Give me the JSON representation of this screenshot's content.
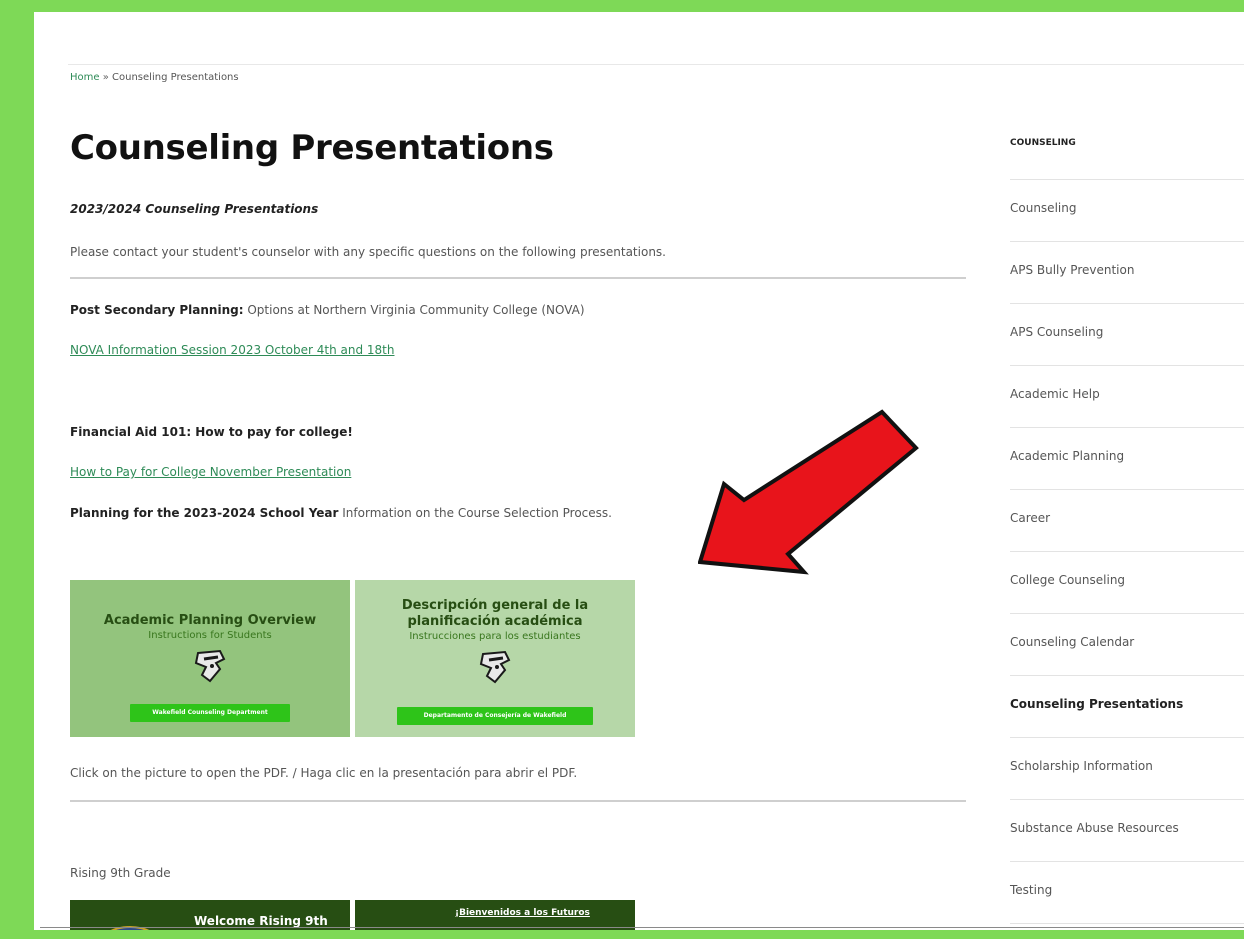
{
  "breadcrumb": {
    "home": "Home",
    "separator": "»",
    "current": "Counseling Presentations"
  },
  "page_title": "Counseling Presentations",
  "subtitle": "2023/2024 Counseling Presentations",
  "intro": "Please contact your student's counselor with any specific questions on the following presentations.",
  "post_secondary": {
    "bold": "Post Secondary Planning:",
    "text": " Options at Northern Virginia Community College (NOVA)"
  },
  "nova_link": "NOVA Information Session 2023 October 4th and 18th",
  "financial_aid": "Financial Aid 101: How to pay for college!",
  "pay_link": "How to Pay for College November Presentation",
  "planning": {
    "bold": "Planning for the 2023-2024 School Year",
    "text": " Information on the Course Selection Process."
  },
  "tiles": [
    {
      "title": "Academic Planning Overview",
      "subtitle": "Instructions for Students",
      "dept": "Wakefield Counseling Department"
    },
    {
      "title": "Descripción general de la planificación académica",
      "subtitle": "Instrucciones para los estudiantes",
      "dept": "Departamento de Consejería de Wakefield"
    }
  ],
  "click_note": "Click on the picture to open the PDF.  / Haga clic en la presentación para abrir el PDF.",
  "rising": "Rising 9th Grade",
  "rising_tiles": {
    "en": "Welcome Rising 9th",
    "es": "¡Bienvenidos a los Futuros"
  },
  "sidebar": {
    "heading": "COUNSELING",
    "items": [
      {
        "label": "Counseling",
        "active": false
      },
      {
        "label": "APS Bully Prevention",
        "active": false
      },
      {
        "label": "APS Counseling",
        "active": false
      },
      {
        "label": "Academic Help",
        "active": false
      },
      {
        "label": "Academic Planning",
        "active": false
      },
      {
        "label": "Career",
        "active": false
      },
      {
        "label": "College Counseling",
        "active": false
      },
      {
        "label": "Counseling Calendar",
        "active": false
      },
      {
        "label": "Counseling Presentations",
        "active": true
      },
      {
        "label": "Scholarship Information",
        "active": false
      },
      {
        "label": "Substance Abuse Resources",
        "active": false
      },
      {
        "label": "Testing",
        "active": false
      }
    ]
  },
  "colors": {
    "frame": "#7ed957",
    "link": "#2e8b57",
    "arrow": "#e8141b",
    "button": "#2ec419"
  },
  "icons": {
    "annotation": "red-arrow-icon",
    "mascot": "mascot-icon"
  }
}
